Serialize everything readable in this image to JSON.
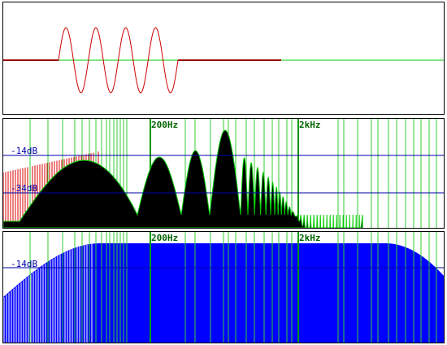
{
  "colors": {
    "background": "#ffffff",
    "border": "#000000",
    "waveform": "#cc0000",
    "baseline": "#00cc00",
    "grid_line": "#00cc00",
    "grid_label": "#006400",
    "db_line": "#0000aa",
    "spectrum_fill": "#000000",
    "spectrum_envelope": "#ff0000",
    "response_fill": "#0000ff"
  },
  "waveform_panel": {
    "cycles": 4
  },
  "spectrum_panel": {
    "freq_labels": [
      "200Hz",
      "2kHz"
    ],
    "db_labels": [
      "-14dB",
      "-34dB"
    ]
  },
  "response_panel": {
    "freq_labels": [
      "200Hz",
      "2kHz"
    ],
    "db_labels": [
      "-14dB"
    ]
  }
}
